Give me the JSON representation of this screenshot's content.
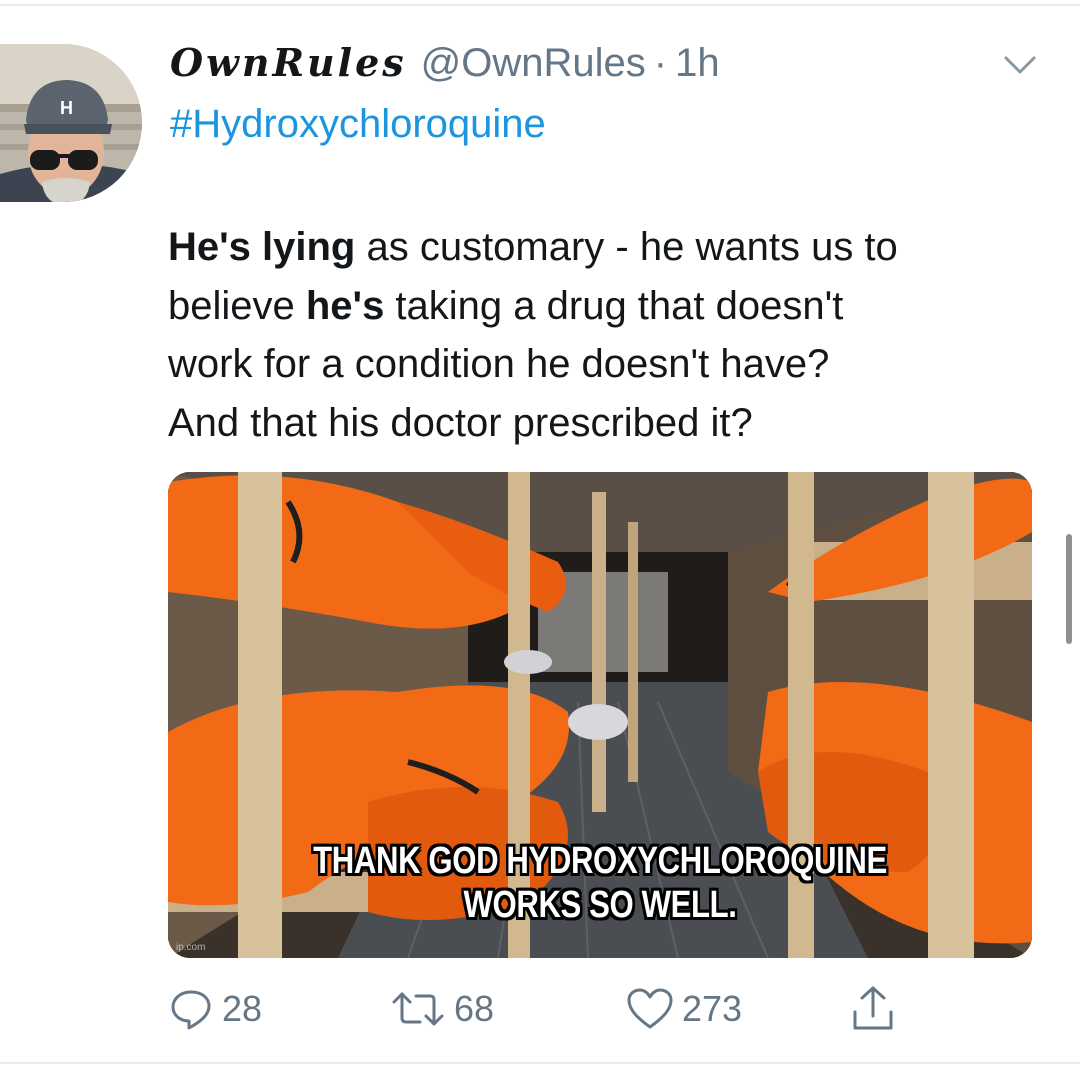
{
  "tweet": {
    "display_name": "OwnRules",
    "handle": "@OwnRules",
    "separator": "·",
    "time": "1h",
    "hashtag": "#Hydroxychloroquine",
    "text_lines": [
      [
        {
          "t": "He's lying",
          "b": true
        },
        {
          "t": " as customary - he wants us to",
          "b": false
        }
      ],
      [
        {
          "t": "believe ",
          "b": false
        },
        {
          "t": "he's",
          "b": true
        },
        {
          "t": " taking a drug that doesn't",
          "b": false
        }
      ],
      [
        {
          "t": "work for a condition he doesn't have?",
          "b": false
        }
      ],
      [
        {
          "t": "And that his doctor prescribed it?",
          "b": false
        }
      ]
    ],
    "media": {
      "caption_line1": "THANK GOD HYDROXYCHLOROQUINE",
      "caption_line2": "WORKS SO WELL.",
      "watermark": "ip.com"
    },
    "actions": {
      "reply_count": "28",
      "retweet_count": "68",
      "like_count": "273"
    }
  },
  "icons": {
    "more": "chevron-down-icon",
    "reply": "reply-icon",
    "retweet": "retweet-icon",
    "like": "heart-icon",
    "share": "share-icon"
  },
  "colors": {
    "link": "#1b95e0",
    "muted": "#657786",
    "text": "#14171a",
    "bag_orange": "#f26a16"
  }
}
